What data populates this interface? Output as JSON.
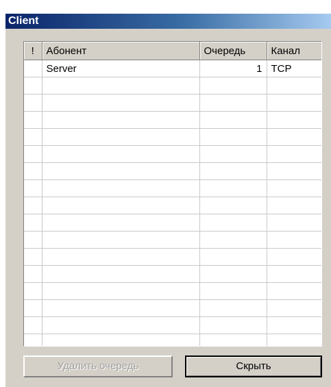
{
  "window": {
    "title": "Client"
  },
  "grid": {
    "columns": [
      {
        "label": "!"
      },
      {
        "label": "Абонент"
      },
      {
        "label": "Очередь"
      },
      {
        "label": "Канал"
      }
    ],
    "rows": [
      {
        "flag": "",
        "subscriber": "Server",
        "queue": "1",
        "channel": "TCP"
      },
      {
        "flag": "",
        "subscriber": "",
        "queue": "",
        "channel": ""
      },
      {
        "flag": "",
        "subscriber": "",
        "queue": "",
        "channel": ""
      },
      {
        "flag": "",
        "subscriber": "",
        "queue": "",
        "channel": ""
      },
      {
        "flag": "",
        "subscriber": "",
        "queue": "",
        "channel": ""
      },
      {
        "flag": "",
        "subscriber": "",
        "queue": "",
        "channel": ""
      },
      {
        "flag": "",
        "subscriber": "",
        "queue": "",
        "channel": ""
      },
      {
        "flag": "",
        "subscriber": "",
        "queue": "",
        "channel": ""
      },
      {
        "flag": "",
        "subscriber": "",
        "queue": "",
        "channel": ""
      },
      {
        "flag": "",
        "subscriber": "",
        "queue": "",
        "channel": ""
      },
      {
        "flag": "",
        "subscriber": "",
        "queue": "",
        "channel": ""
      },
      {
        "flag": "",
        "subscriber": "",
        "queue": "",
        "channel": ""
      },
      {
        "flag": "",
        "subscriber": "",
        "queue": "",
        "channel": ""
      },
      {
        "flag": "",
        "subscriber": "",
        "queue": "",
        "channel": ""
      },
      {
        "flag": "",
        "subscriber": "",
        "queue": "",
        "channel": ""
      },
      {
        "flag": "",
        "subscriber": "",
        "queue": "",
        "channel": ""
      },
      {
        "flag": "",
        "subscriber": "",
        "queue": "",
        "channel": ""
      }
    ]
  },
  "buttons": {
    "delete_queue": "Удалить очередь",
    "hide": "Скрыть"
  },
  "colors": {
    "title_gradient_start": "#0a246a",
    "title_gradient_end": "#a6caf0",
    "face": "#d4d0c8",
    "disabled_text": "#a0a0a0"
  }
}
